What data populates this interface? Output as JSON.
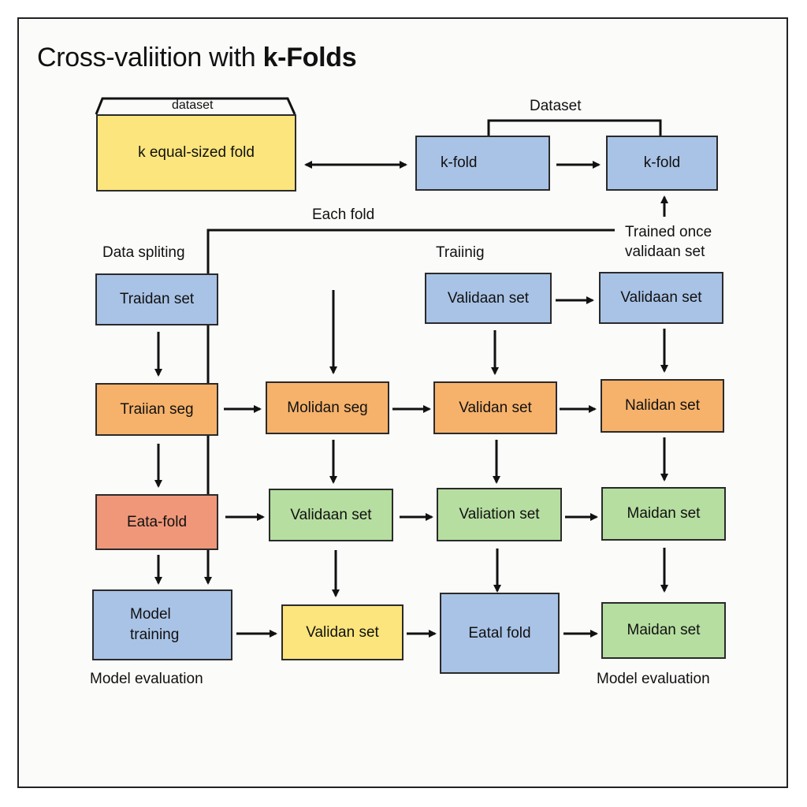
{
  "title": {
    "prefix": "Cross-valiition with ",
    "bold": "k-Folds"
  },
  "dataset_tab": "dataset",
  "dataset_box": "k equal-sized fold",
  "dataset_header": "Dataset",
  "kfold_left": "k-fold",
  "kfold_right": "k-fold",
  "each_fold": "Each fold",
  "trained_once": "Trained once\nvalidaan set",
  "data_spliting": "Data spliting",
  "training_label": "Traiinig",
  "grid": {
    "r1": [
      "Traidan set",
      "Validaan set",
      "Validaan set"
    ],
    "r2": [
      "Traiian seg",
      "Molidan seg",
      "Validan set",
      "Nalidan set"
    ],
    "r3": [
      "Eata-fold",
      "Validaan set",
      "Valiation set",
      "Maidan set"
    ],
    "r4": [
      "Model\ntraining",
      "Validan set",
      "Eatal fold",
      "Maidan set"
    ]
  },
  "model_eval_left": "Model evaluation",
  "model_eval_right": "Model evaluation",
  "colors": {
    "blue": "#a9c3e6",
    "orange": "#f6b26b",
    "green": "#b6dea0",
    "yellow": "#fbe57c",
    "red": "#f0977a",
    "line": "#111111"
  }
}
